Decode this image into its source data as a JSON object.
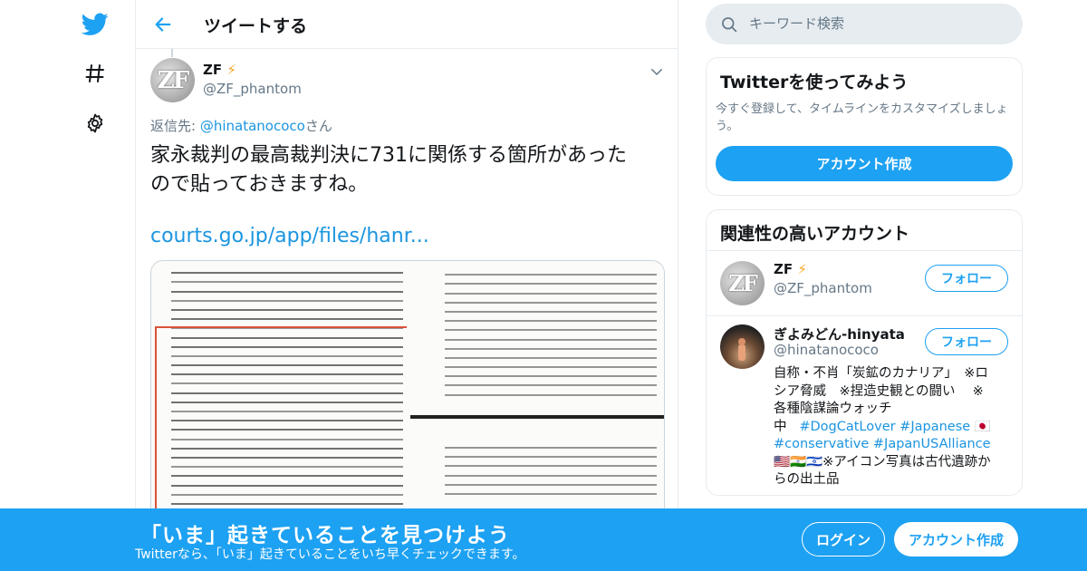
{
  "header": {
    "title": "ツイートする"
  },
  "tweet": {
    "author_name": "ZF",
    "author_emoji": "⚡",
    "author_handle": "@ZF_phantom",
    "avatar_text": "ZF",
    "reply_prefix": "返信先: ",
    "reply_handle": "@hinatanococo",
    "reply_suffix": "さん",
    "text_line1": "家永裁判の最高裁判決に731に関係する箇所があった",
    "text_line2": "ので貼っておきますね。",
    "link": "courts.go.jp/app/files/hanr..."
  },
  "search": {
    "placeholder": "キーワード検索"
  },
  "signup_card": {
    "title": "Twitterを使ってみよう",
    "description": "今すぐ登録して、タイムラインをカスタマイズしましょう。",
    "button": "アカウント作成"
  },
  "related_card": {
    "title": "関連性の高いアカウント",
    "accounts": [
      {
        "name": "ZF",
        "emoji": "⚡",
        "handle": "@ZF_phantom",
        "follow": "フォロー"
      },
      {
        "name": "ぎよみどん-hinyata",
        "handle": "@hinatanococo",
        "follow": "フォロー",
        "bio_line1": "自称・不肖「炭鉱のカナリア」　※ロ",
        "bio_line2": "シア脅威　※捏造史観との闘い　 ※",
        "bio_line3": "各種陰謀論ウォッチ",
        "bio_line4_text": "中",
        "bio_tags1": "#DogCatLover #Japanese",
        "bio_tags2": "#conservative #JapanUSAlliance",
        "bio_flags": "🇺🇸🇮🇳🇮🇱",
        "bio_line6": "※アイコン写真は古代遺跡か",
        "bio_line7": "らの出土品"
      }
    ]
  },
  "bottom_bar": {
    "title": "「いま」起きていることを見つけよう",
    "subtitle": "Twitterなら、「いま」起きていることをいち早くチェックできます。",
    "login": "ログイン",
    "signup": "アカウント作成"
  },
  "colors": {
    "accent": "#1da1f2",
    "border": "#e6ecf0",
    "muted": "#657786"
  }
}
